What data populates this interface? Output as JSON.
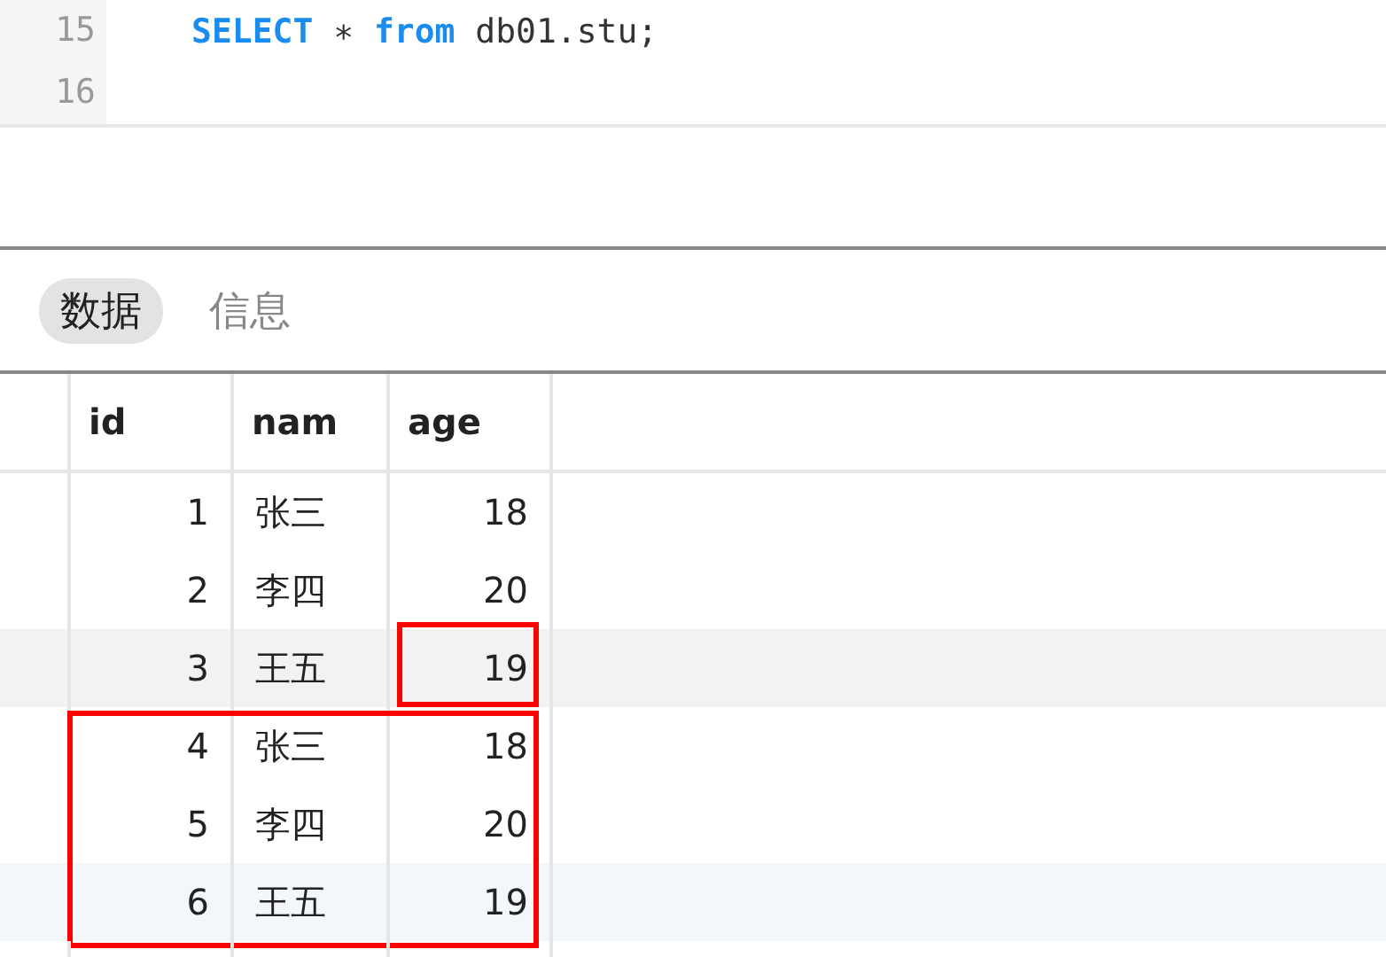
{
  "editor": {
    "lines": [
      {
        "number": "15",
        "tokens": [
          {
            "kind": "keyword",
            "text": "SELECT"
          },
          {
            "kind": "plain",
            "text": " ∗ "
          },
          {
            "kind": "keyword",
            "text": "from"
          },
          {
            "kind": "plain",
            "text": " db01.stu;"
          }
        ]
      },
      {
        "number": "16"
      }
    ]
  },
  "tabs": [
    {
      "label": "数据",
      "selected": true
    },
    {
      "label": "信息",
      "selected": false
    }
  ],
  "table": {
    "columns": [
      "id",
      "nam",
      "age"
    ],
    "rows": [
      {
        "cells": [
          "1",
          "张三",
          "18"
        ],
        "hovered": false,
        "selected": false,
        "age_outlined": false,
        "group_outlined": false
      },
      {
        "cells": [
          "2",
          "李四",
          "20"
        ],
        "hovered": false,
        "selected": false,
        "age_outlined": false,
        "group_outlined": false
      },
      {
        "cells": [
          "3",
          "王五",
          "19"
        ],
        "hovered": true,
        "selected": false,
        "age_outlined": true,
        "group_outlined": false
      },
      {
        "cells": [
          "4",
          "张三",
          "18"
        ],
        "hovered": false,
        "selected": false,
        "age_outlined": false,
        "group_outlined": true
      },
      {
        "cells": [
          "5",
          "李四",
          "20"
        ],
        "hovered": false,
        "selected": false,
        "age_outlined": false,
        "group_outlined": true
      },
      {
        "cells": [
          "6",
          "王五",
          "19"
        ],
        "hovered": false,
        "selected": true,
        "age_outlined": false,
        "group_outlined": true
      }
    ]
  }
}
